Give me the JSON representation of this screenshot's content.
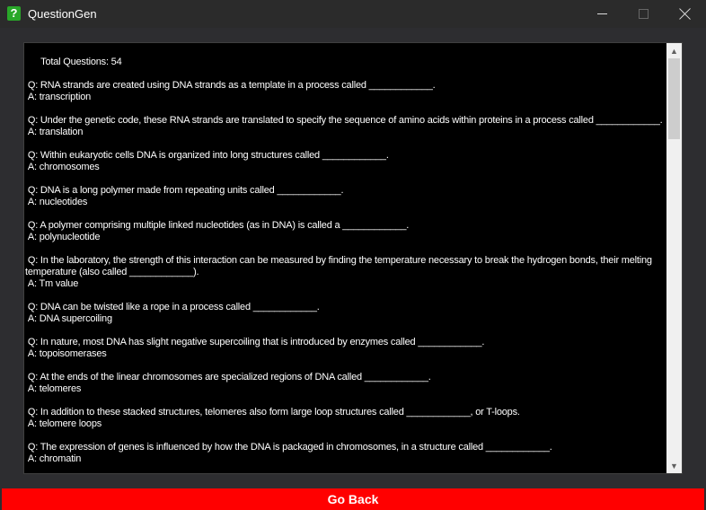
{
  "window": {
    "title": "QuestionGen",
    "icon": "question-mark-icon"
  },
  "header": {
    "total_label": "Total Questions: 54"
  },
  "items": [
    {
      "q": " Q: RNA strands are created using DNA strands as a template in a process called ____________.",
      "a": " A: transcription"
    },
    {
      "q": " Q: Under the genetic code, these RNA strands are translated to specify the sequence of amino acids within proteins in a process called ____________.",
      "a": " A: translation"
    },
    {
      "q": " Q: Within eukaryotic cells DNA is organized into long structures called ____________.",
      "a": " A: chromosomes"
    },
    {
      "q": " Q: DNA is a long polymer made from repeating units called ____________.",
      "a": " A: nucleotides"
    },
    {
      "q": " Q: A polymer comprising multiple linked nucleotides (as in DNA) is called a ____________.",
      "a": " A: polynucleotide"
    },
    {
      "q": " Q: In the laboratory, the strength of this interaction can be measured by finding the temperature necessary to break the hydrogen bonds, their melting temperature (also called ____________).",
      "a": " A: Tm value"
    },
    {
      "q": " Q: DNA can be twisted like a rope in a process called ____________.",
      "a": " A: DNA supercoiling"
    },
    {
      "q": " Q: In nature, most DNA has slight negative supercoiling that is introduced by enzymes called ____________.",
      "a": " A: topoisomerases"
    },
    {
      "q": " Q: At the ends of the linear chromosomes are specialized regions of DNA called ____________.",
      "a": " A: telomeres"
    },
    {
      "q": " Q: In addition to these stacked structures, telomeres also form large loop structures called ____________, or T-loops.",
      "a": " A: telomere loops"
    },
    {
      "q": " Q: The expression of genes is influenced by how the DNA is packaged in chromosomes, in a structure called ____________.",
      "a": " A: chromatin"
    }
  ],
  "footer": {
    "go_back_label": "Go Back"
  },
  "colors": {
    "titlebar": "#2b2b2b",
    "text_bg": "#000000",
    "go_back_bg": "#ff0000",
    "app_icon": "#29a829"
  }
}
